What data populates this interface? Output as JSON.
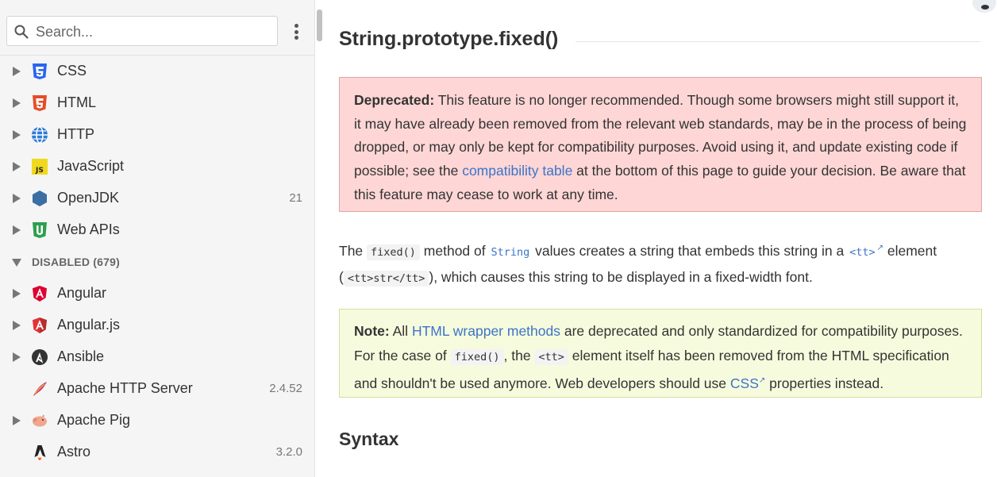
{
  "search": {
    "placeholder": "Search..."
  },
  "sidebar": {
    "enabled_items": [
      {
        "label": "CSS",
        "icon": "css-icon",
        "version": ""
      },
      {
        "label": "HTML",
        "icon": "html-icon",
        "version": ""
      },
      {
        "label": "HTTP",
        "icon": "http-icon",
        "version": ""
      },
      {
        "label": "JavaScript",
        "icon": "javascript-icon",
        "version": ""
      },
      {
        "label": "OpenJDK",
        "icon": "openjdk-icon",
        "version": "21"
      },
      {
        "label": "Web APIs",
        "icon": "web-apis-icon",
        "version": ""
      }
    ],
    "disabled_section": {
      "title": "DISABLED (679)"
    },
    "disabled_items": [
      {
        "label": "Angular",
        "icon": "angular-icon",
        "version": ""
      },
      {
        "label": "Angular.js",
        "icon": "angularjs-icon",
        "version": ""
      },
      {
        "label": "Ansible",
        "icon": "ansible-icon",
        "version": ""
      },
      {
        "label": "Apache HTTP Server",
        "icon": "apache-feather-icon",
        "version": "2.4.52"
      },
      {
        "label": "Apache Pig",
        "icon": "apache-pig-icon",
        "version": ""
      },
      {
        "label": "Astro",
        "icon": "astro-icon",
        "version": "3.2.0"
      }
    ]
  },
  "main": {
    "title": "String.prototype.fixed()",
    "deprecated": {
      "label": "Deprecated:",
      "text_before": " This feature is no longer recommended. Though some browsers might still support it, it may have already been removed from the relevant web standards, may be in the process of being dropped, or may only be kept for compatibility purposes. Avoid using it, and update existing code if possible; see the ",
      "link": "compatibility table",
      "text_after": " at the bottom of this page to guide your decision. Be aware that this feature may cease to work at any time."
    },
    "intro": {
      "t1": "The ",
      "code1": "fixed()",
      "t2": " method of ",
      "code2": "String",
      "t3": " values creates a string that embeds this string in a ",
      "code3": "<tt>",
      "t4": " element (",
      "code4": "<tt>str</tt>",
      "t5": "), which causes this string to be displayed in a fixed-width font."
    },
    "note": {
      "label": "Note:",
      "t1": " All ",
      "link1": "HTML wrapper methods",
      "t2": " are deprecated and only standardized for compatibility purposes. For the case of ",
      "code1": "fixed()",
      "t3": ", the ",
      "code2": "<tt>",
      "t4": " element itself has been removed from the HTML specification and shouldn't be used anymore. Web developers should use ",
      "link2": "CSS",
      "t5": " properties instead."
    },
    "syntax_heading": "Syntax"
  }
}
